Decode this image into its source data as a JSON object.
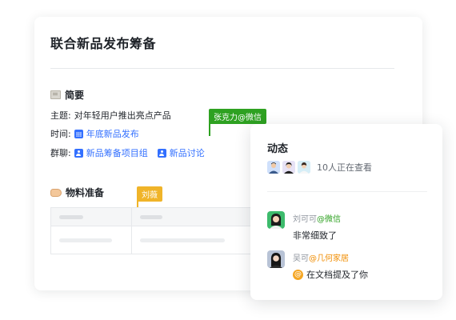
{
  "doc": {
    "title": "联合新品发布筹备",
    "brief": {
      "heading": "简要",
      "icon": "notebook-icon",
      "topic_label": "主题:",
      "topic_value": "对年轻用户推出亮点产品",
      "time_label": "时间:",
      "time_value": "年底新品发布",
      "group_label": "群聊:",
      "groups": [
        "新品筹备项目组",
        "新品讨论"
      ]
    },
    "material": {
      "heading": "物料准备",
      "icon": "hand-icon"
    },
    "cursors": [
      {
        "label": "张克力@微信",
        "color": "#2ea121"
      },
      {
        "label": "刘薇",
        "color": "#f0b429"
      }
    ]
  },
  "activity": {
    "title": "动态",
    "viewing_text": "10人正在查看",
    "comments": [
      {
        "author": "刘可可",
        "org": "@微信",
        "org_color": "#2ea121",
        "text": "非常细致了"
      },
      {
        "author": "吴可",
        "org": "@几何家居",
        "org_color": "#f08c00",
        "text": "在文档提及了你",
        "icon": "at-mention-icon"
      }
    ]
  },
  "colors": {
    "link": "#3370ff",
    "text": "#1f2329",
    "muted": "#8f959e"
  }
}
